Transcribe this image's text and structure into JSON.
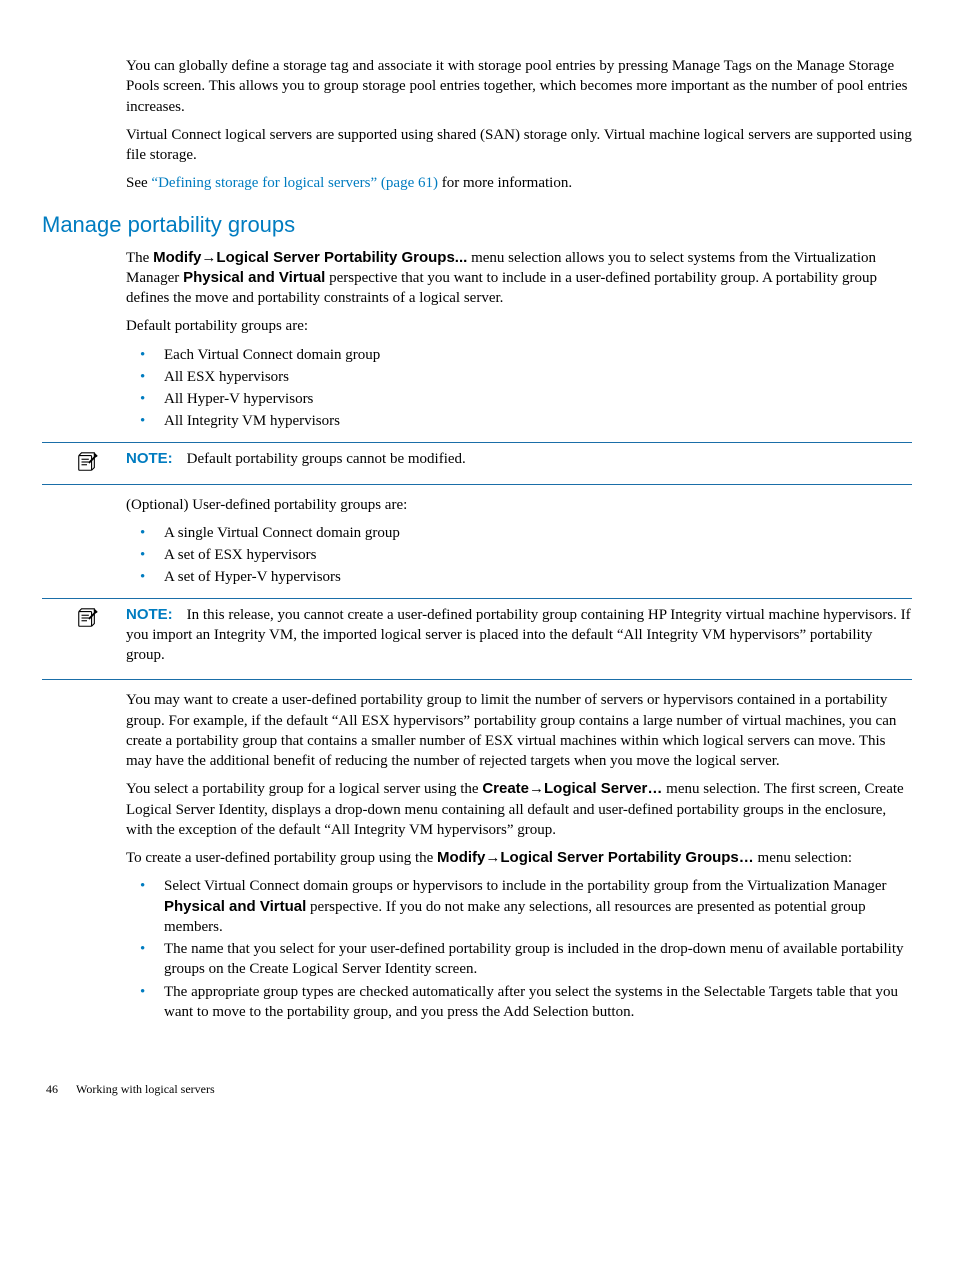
{
  "intro": {
    "p1": "You can globally define a storage tag and associate it with storage pool entries by pressing Manage Tags on the Manage Storage Pools screen. This allows you to group storage pool entries together, which becomes more important as the number of pool entries increases.",
    "p2": "Virtual Connect logical servers are supported using shared (SAN) storage only. Virtual machine logical servers are supported using file storage.",
    "p3_prefix": "See ",
    "p3_link": "“Defining storage for logical servers” (page 61)",
    "p3_suffix": " for more information."
  },
  "section": {
    "heading": "Manage portability groups",
    "p1_a": "The ",
    "p1_bold1": "Modify",
    "p1_arrow1": "→",
    "p1_bold2": "Logical Server Portability Groups...",
    "p1_b": " menu selection allows you to select systems from the Virtualization Manager ",
    "p1_bold3": "Physical and Virtual",
    "p1_c": " perspective that you want to include in a user-defined portability group. A portability group defines the move and portability constraints of a logical server.",
    "p2": "Default portability groups are:",
    "defaults": [
      "Each Virtual Connect domain group",
      "All ESX hypervisors",
      "All Hyper-V hypervisors",
      "All Integrity VM hypervisors"
    ],
    "note1_label": "NOTE:",
    "note1_text": "Default portability groups cannot be modified.",
    "p3": "(Optional) User-defined portability groups are:",
    "optionals": [
      "A single Virtual Connect domain group",
      "A set of ESX hypervisors",
      "A set of Hyper-V hypervisors"
    ],
    "note2_label": "NOTE:",
    "note2_text": "In this release, you cannot create a user-defined portability group containing HP Integrity virtual machine hypervisors. If you import an Integrity VM, the imported logical server is placed into the default “All Integrity VM hypervisors” portability group.",
    "p4": "You may want to create a user-defined portability group to limit the number of servers or hypervisors contained in a portability group. For example, if the default “All ESX hypervisors” portability group contains a large number of virtual machines, you can create a portability group that contains a smaller number of ESX virtual machines within which logical servers can move. This may have the additional benefit of reducing the number of rejected targets when you move the logical server.",
    "p5_a": "You select a portability group for a logical server using the ",
    "p5_bold1": "Create",
    "p5_arrow1": "→",
    "p5_bold2": "Logical Server…",
    "p5_b": " menu selection. The first screen, Create Logical Server Identity, displays a drop-down menu containing all default and user-defined portability groups in the enclosure, with the exception of the default “All Integrity VM hypervisors” group.",
    "p6_a": "To create a user-defined portability group using the ",
    "p6_bold1": "Modify",
    "p6_arrow1": "→",
    "p6_bold2": "Logical Server Portability Groups…",
    "p6_b": " menu selection:",
    "steps": {
      "s1_a": "Select Virtual Connect domain groups or hypervisors to include in the portability group from the Virtualization Manager ",
      "s1_bold": "Physical and Virtual",
      "s1_b": " perspective. If you do not make any selections, all resources are presented as potential group members.",
      "s2": "The name that you select for your user-defined portability group is included in the drop-down menu of available portability groups on the Create Logical Server Identity screen.",
      "s3": "The appropriate group types are checked automatically after you select the systems in the Selectable Targets table that you want to move to the portability group, and you press the Add Selection button."
    }
  },
  "footer": {
    "page": "46",
    "title": "Working with logical servers"
  }
}
